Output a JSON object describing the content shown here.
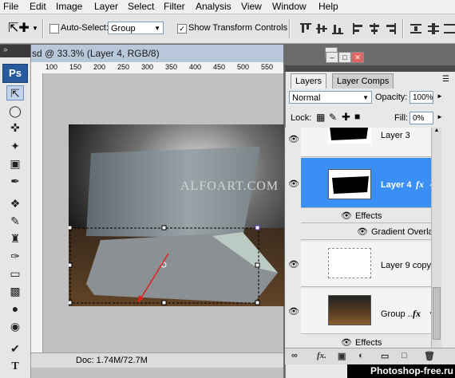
{
  "menu": [
    "File",
    "Edit",
    "Image",
    "Layer",
    "Select",
    "Filter",
    "Analysis",
    "View",
    "Window",
    "Help"
  ],
  "options": {
    "auto_select_label": "Auto-Select:",
    "auto_select_checked": false,
    "auto_select_value": "Group",
    "show_transform_label": "Show Transform Controls",
    "show_transform_checked": true
  },
  "document": {
    "title": "sd @ 33.3% (Layer 4, RGB/8)",
    "ruler_ticks": [
      "100",
      "150",
      "200",
      "250",
      "300",
      "350",
      "400",
      "450",
      "500",
      "550"
    ],
    "watermark_text": "ALFOART.COM",
    "status": "Doc: 1.74M/72.7M"
  },
  "tools": {
    "logo": "Ps"
  },
  "layers_panel": {
    "tabs": [
      "Layers",
      "Layer Comps"
    ],
    "blend_mode": "Normal",
    "opacity_label": "Opacity:",
    "opacity_value": "100%",
    "lock_label": "Lock:",
    "fill_label": "Fill:",
    "fill_value": "0%",
    "layers": [
      {
        "name": "Layer 3"
      },
      {
        "name": "Layer 4",
        "selected": true,
        "fx": "fx"
      },
      {
        "name": "Effects"
      },
      {
        "name": "Gradient Overlay"
      },
      {
        "name": "Layer 9 copy"
      },
      {
        "name": "Group ...",
        "fx": "fx"
      },
      {
        "name": "Effects"
      }
    ]
  },
  "site_watermark": "Photoshop-free.ru",
  "colors": {
    "selection": "#3a8ff4",
    "ps_logo": "#2a5a9e"
  }
}
